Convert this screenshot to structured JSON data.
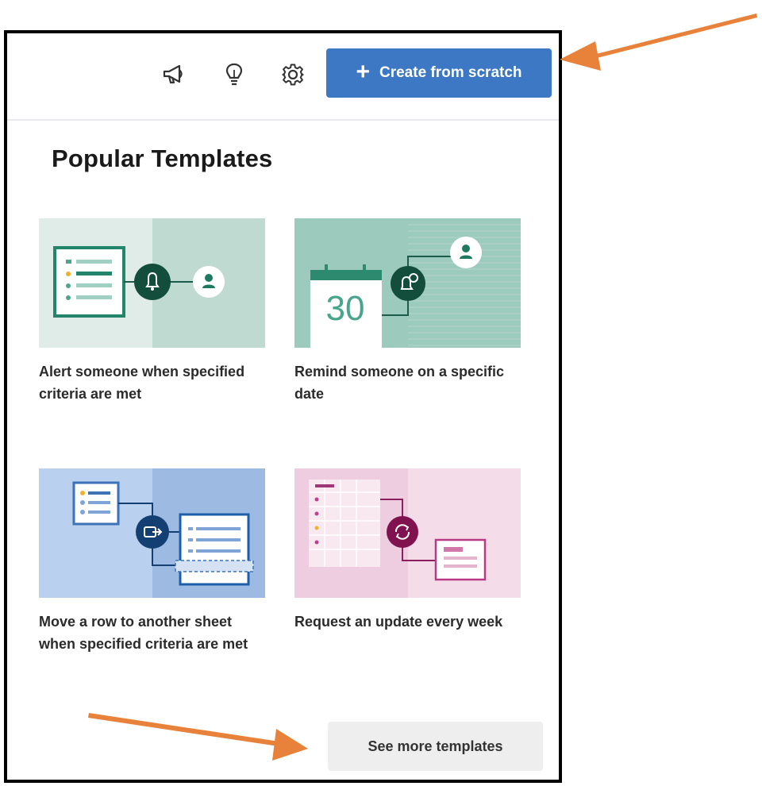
{
  "toolbar": {
    "icons": [
      "megaphone-icon",
      "lightbulb-icon",
      "gear-icon",
      "plus-icon"
    ],
    "create_label": "Create from scratch"
  },
  "templates": {
    "heading": "Popular Templates",
    "cards": [
      {
        "label": "Alert someone when specified criteria are met",
        "icon": "bell-icon"
      },
      {
        "label": "Remind someone on a specific date",
        "icon": "calendar-icon",
        "calendar_number": "30"
      },
      {
        "label": "Move a row to another sheet when specified criteria are met",
        "icon": "move-row-icon"
      },
      {
        "label": "Request an update every week",
        "icon": "refresh-icon"
      }
    ],
    "see_more_label": "See more templates"
  },
  "colors": {
    "primary_button": "#3c78c3",
    "annotation_arrow": "#e8823a",
    "alert_card": "#c4ddd6",
    "remind_card": "#9ccabc",
    "move_card": "#a3c0e6",
    "request_card": "#f4dde9"
  }
}
